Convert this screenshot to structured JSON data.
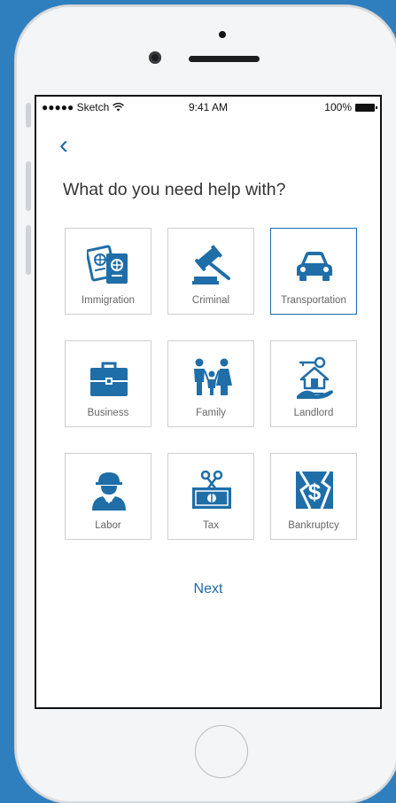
{
  "status_bar": {
    "carrier": "●●●●● Sketch",
    "time": "9:41 AM",
    "battery": "100%"
  },
  "nav": {
    "back_glyph": "‹"
  },
  "title": "What do you need help with?",
  "categories": [
    {
      "label": "Immigration",
      "icon": "passport-icon"
    },
    {
      "label": "Criminal",
      "icon": "gavel-icon"
    },
    {
      "label": "Transportation",
      "icon": "car-icon",
      "selected": true
    },
    {
      "label": "Business",
      "icon": "briefcase-icon"
    },
    {
      "label": "Family",
      "icon": "family-icon"
    },
    {
      "label": "Landlord",
      "icon": "house-key-icon"
    },
    {
      "label": "Labor",
      "icon": "worker-icon"
    },
    {
      "label": "Tax",
      "icon": "money-scissors-icon"
    },
    {
      "label": "Bankruptcy",
      "icon": "broken-dollar-icon"
    }
  ],
  "next_label": "Next",
  "colors": {
    "accent": "#1d6aa8",
    "background": "#2f7fbe",
    "icon": "#1f6ea8"
  }
}
